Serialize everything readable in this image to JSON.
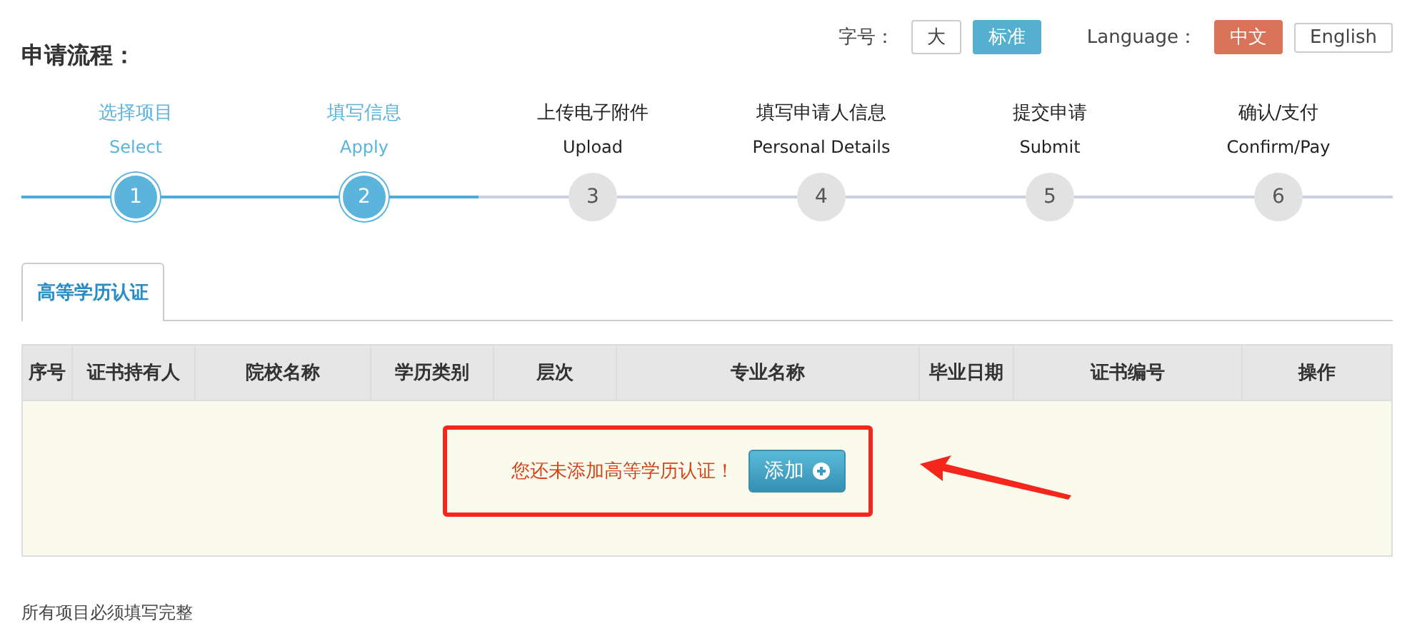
{
  "title": "申请流程：",
  "font_size": {
    "label": "字号：",
    "options": [
      {
        "label": "大",
        "selected": false
      },
      {
        "label": "标准",
        "selected": true
      }
    ]
  },
  "language": {
    "label": "Language：",
    "options": [
      {
        "label": "中文",
        "selected": true
      },
      {
        "label": "English",
        "selected": false
      }
    ]
  },
  "steps": [
    {
      "title": "选择项目",
      "subtitle": "Select",
      "number": "1",
      "done": true
    },
    {
      "title": "填写信息",
      "subtitle": "Apply",
      "number": "2",
      "done": true
    },
    {
      "title": "上传电子附件",
      "subtitle": "Upload",
      "number": "3",
      "done": false
    },
    {
      "title": "填写申请人信息",
      "subtitle": "Personal Details",
      "number": "4",
      "done": false
    },
    {
      "title": "提交申请",
      "subtitle": "Submit",
      "number": "5",
      "done": false
    },
    {
      "title": "确认/支付",
      "subtitle": "Confirm/Pay",
      "number": "6",
      "done": false
    }
  ],
  "tabs": [
    {
      "label": "高等学历认证",
      "selected": true
    }
  ],
  "table": {
    "columns": [
      "序号",
      "证书持有人",
      "院校名称",
      "学历类别",
      "层次",
      "专业名称",
      "毕业日期",
      "证书编号",
      "操作"
    ],
    "empty_message": "您还未添加高等学历认证！",
    "add_button": "添加"
  },
  "footer_note": "所有项目必须填写完整"
}
